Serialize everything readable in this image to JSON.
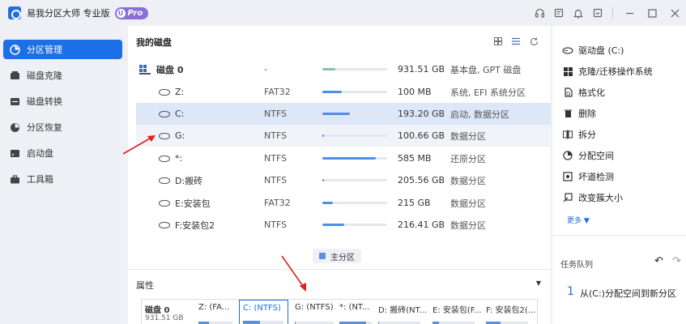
{
  "app": {
    "title": "易我分区大师 专业版",
    "badge_letter": "U",
    "badge": "Pro"
  },
  "sidebar": {
    "items": [
      {
        "label": "分区管理",
        "icon": "pie-chart-icon",
        "active": true
      },
      {
        "label": "磁盘克隆",
        "icon": "disk-clone-icon",
        "active": false
      },
      {
        "label": "磁盘转换",
        "icon": "disk-convert-icon",
        "active": false
      },
      {
        "label": "分区恢复",
        "icon": "recover-icon",
        "active": false
      },
      {
        "label": "启动盘",
        "icon": "boot-disk-icon",
        "active": false
      },
      {
        "label": "工具箱",
        "icon": "toolbox-icon",
        "active": false
      }
    ]
  },
  "main": {
    "title": "我的磁盘",
    "rows": [
      {
        "name": "磁盘 0",
        "fs": "-",
        "size": "931.51 GB",
        "type": "基本盘, GPT 磁盘",
        "usage": 0.2,
        "kind": "disk"
      },
      {
        "name": "Z:",
        "fs": "FAT32",
        "size": "100 MB",
        "type": "系统, EFI 系统分区",
        "usage": 0.3,
        "kind": "part"
      },
      {
        "name": "C:",
        "fs": "NTFS",
        "size": "193.20 GB",
        "type": "启动, 数据分区",
        "usage": 0.42,
        "kind": "part",
        "selected": true
      },
      {
        "name": "G:",
        "fs": "NTFS",
        "size": "100.66 GB",
        "type": "数据分区",
        "usage": 0.02,
        "kind": "part"
      },
      {
        "name": "*:",
        "fs": "NTFS",
        "size": "585 MB",
        "type": "还原分区",
        "usage": 0.82,
        "kind": "part"
      },
      {
        "name": "D:搬砖",
        "fs": "NTFS",
        "size": "205.56 GB",
        "type": "数据分区",
        "usage": 0.02,
        "kind": "part"
      },
      {
        "name": "E:安装包",
        "fs": "FAT32",
        "size": "215 GB",
        "type": "数据分区",
        "usage": 0.16,
        "kind": "part"
      },
      {
        "name": "F:安装包2",
        "fs": "NTFS",
        "size": "216.41 GB",
        "type": "数据分区",
        "usage": 0.34,
        "kind": "part"
      }
    ],
    "legend": "主分区",
    "properties_label": "属性",
    "map": [
      {
        "label": "磁盘 0",
        "sub": "931.51 GB",
        "usage": 0
      },
      {
        "label": "Z: (FA...",
        "usage": 0.3
      },
      {
        "label": "C: (NTFS)",
        "usage": 0.42,
        "selected": true
      },
      {
        "label": "G: (NTFS)",
        "usage": 0.02
      },
      {
        "label": "*: (NT...",
        "usage": 0.82
      },
      {
        "label": "D: 搬砖(NT...",
        "usage": 0.02
      },
      {
        "label": "E: 安装包(F...",
        "usage": 0.16
      },
      {
        "label": "F: 安装包2(...",
        "usage": 0.34
      }
    ]
  },
  "operations": {
    "header": "驱动盘 (C:)",
    "items": [
      {
        "label": "克隆/迁移操作系统",
        "icon": "windows-icon"
      },
      {
        "label": "格式化",
        "icon": "format-icon"
      },
      {
        "label": "删除",
        "icon": "trash-icon"
      },
      {
        "label": "拆分",
        "icon": "split-icon"
      },
      {
        "label": "分配空间",
        "icon": "allocate-icon"
      },
      {
        "label": "坏道检测",
        "icon": "scan-icon"
      },
      {
        "label": "改变簇大小",
        "icon": "cluster-icon"
      }
    ],
    "more": "更多 ▼"
  },
  "tasks": {
    "label": "任务队列",
    "items": [
      {
        "num": "1",
        "text": "从(C:)分配空间到新分区"
      }
    ]
  },
  "colors": {
    "accent": "#1c6fe6",
    "selected_row": "#dde7f8",
    "arrow": "#e02020"
  }
}
